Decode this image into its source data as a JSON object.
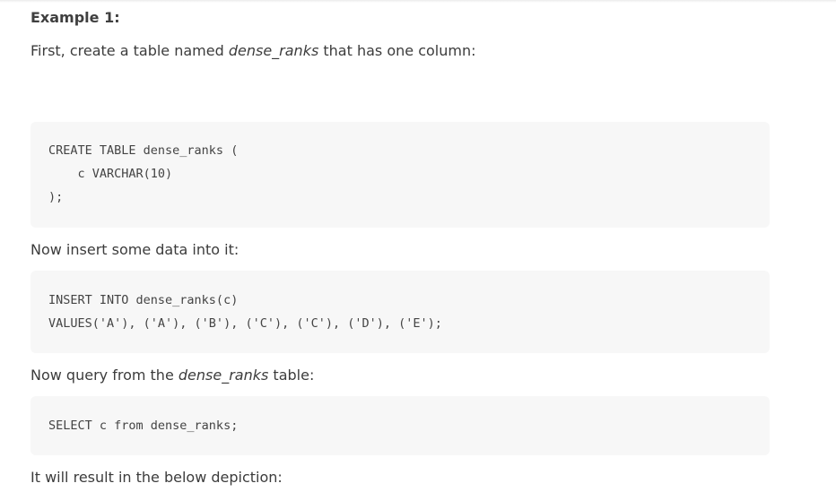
{
  "example": {
    "heading": "Example 1:"
  },
  "para1": {
    "prefix": "First, create a table named ",
    "table_name": "dense_ranks",
    "suffix": " that has one column:"
  },
  "code1": {
    "lines": [
      "CREATE TABLE dense_ranks (",
      "    c VARCHAR(10)",
      ");"
    ]
  },
  "para2": {
    "text": "Now insert some data into it:"
  },
  "code2": {
    "lines": [
      "INSERT INTO dense_ranks(c)",
      "VALUES('A'), ('A'), ('B'), ('C'), ('C'), ('D'), ('E');"
    ]
  },
  "para3": {
    "prefix": "Now query from the ",
    "table_name": "dense_ranks",
    "suffix": " table:"
  },
  "code3": {
    "lines": [
      "SELECT c from dense_ranks;"
    ]
  },
  "para4": {
    "text": "It will result in the below depiction:"
  }
}
